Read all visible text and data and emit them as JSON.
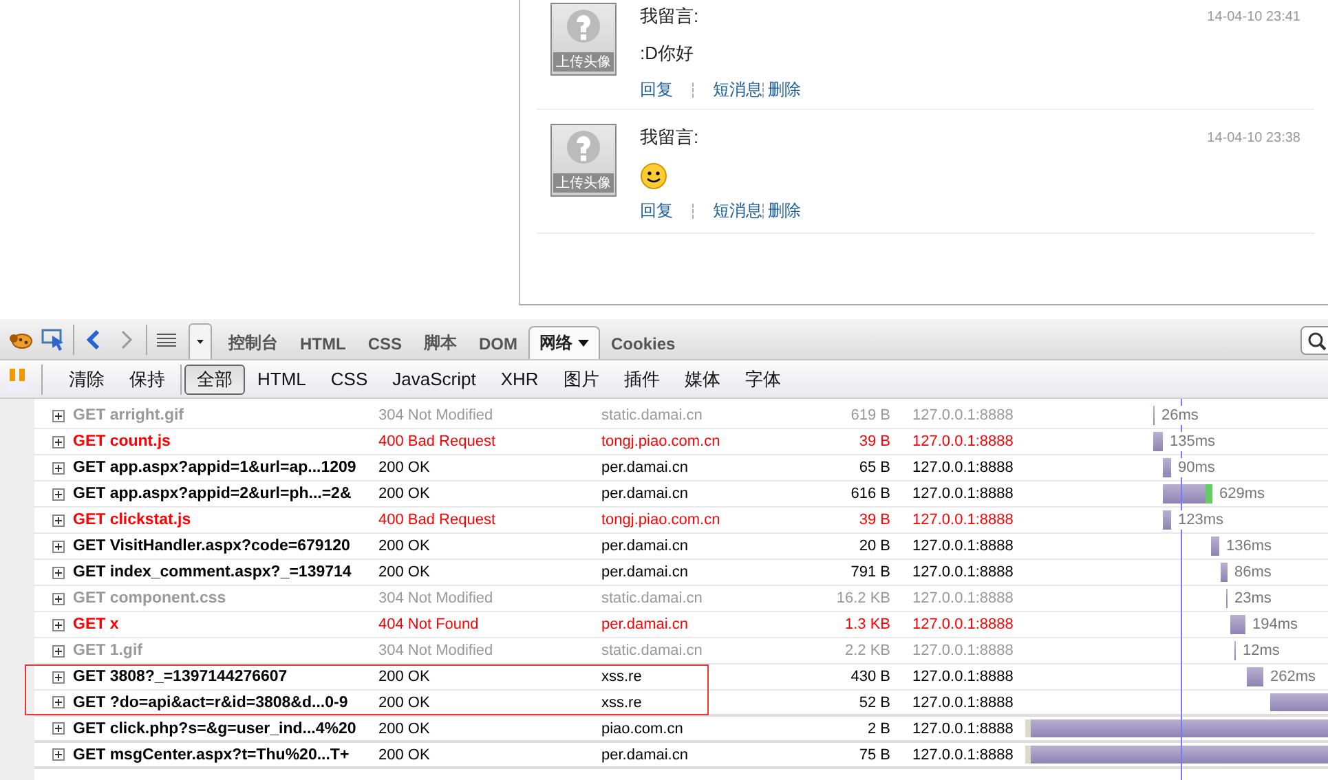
{
  "comments": [
    {
      "author": "我留言:",
      "time": "14-04-10 23:41",
      "kind": "text",
      "content": ":D你好",
      "avatar_caption": "上传头像",
      "actions": [
        "回复",
        "短消息",
        "删除"
      ]
    },
    {
      "author": "我留言:",
      "time": "14-04-10 23:38",
      "kind": "smiley",
      "avatar_caption": "上传头像",
      "actions": [
        "回复",
        "短消息",
        "删除"
      ]
    }
  ],
  "toolbar": {
    "tabs": [
      {
        "label": "控制台",
        "selected": false
      },
      {
        "label": "HTML",
        "selected": false
      },
      {
        "label": "CSS",
        "selected": false
      },
      {
        "label": "脚本",
        "selected": false
      },
      {
        "label": "DOM",
        "selected": false
      },
      {
        "label": "网络",
        "selected": true,
        "dropdown": true
      },
      {
        "label": "Cookies",
        "selected": false
      }
    ]
  },
  "filter_bar": {
    "actions": [
      "清除",
      "保持"
    ],
    "filters": [
      {
        "label": "全部",
        "selected": true
      },
      {
        "label": "HTML",
        "selected": false
      },
      {
        "label": "CSS",
        "selected": false
      },
      {
        "label": "JavaScript",
        "selected": false
      },
      {
        "label": "XHR",
        "selected": false
      },
      {
        "label": "图片",
        "selected": false
      },
      {
        "label": "插件",
        "selected": false
      },
      {
        "label": "媒体",
        "selected": false
      },
      {
        "label": "字体",
        "selected": false
      }
    ]
  },
  "requests": [
    {
      "kind": "cached",
      "url": "GET arright.gif",
      "status": "304 Not Modified",
      "domain": "static.damai.cn",
      "size": "619 B",
      "remote": "127.0.0.1:8888",
      "highlighted": false,
      "timing": "26ms"
    },
    {
      "kind": "error",
      "url": "GET count.js",
      "status": "400 Bad Request",
      "domain": "tongj.piao.com.cn",
      "size": "39 B",
      "remote": "127.0.0.1:8888",
      "highlighted": false,
      "timing": "135ms"
    },
    {
      "kind": "ok",
      "url": "GET app.aspx?appid=1&url=ap...1209",
      "status": "200 OK",
      "domain": "per.damai.cn",
      "size": "65 B",
      "remote": "127.0.0.1:8888",
      "highlighted": false,
      "timing": "90ms"
    },
    {
      "kind": "ok",
      "url": "GET app.aspx?appid=2&url=ph...=2&",
      "status": "200 OK",
      "domain": "per.damai.cn",
      "size": "616 B",
      "remote": "127.0.0.1:8888",
      "highlighted": false,
      "timing": "629ms"
    },
    {
      "kind": "error",
      "url": "GET clickstat.js",
      "status": "400 Bad Request",
      "domain": "tongj.piao.com.cn",
      "size": "39 B",
      "remote": "127.0.0.1:8888",
      "highlighted": false,
      "timing": "123ms"
    },
    {
      "kind": "ok",
      "url": "GET VisitHandler.aspx?code=679120",
      "status": "200 OK",
      "domain": "per.damai.cn",
      "size": "20 B",
      "remote": "127.0.0.1:8888",
      "highlighted": false,
      "timing": "136ms"
    },
    {
      "kind": "ok",
      "url": "GET index_comment.aspx?_=139714",
      "status": "200 OK",
      "domain": "per.damai.cn",
      "size": "791 B",
      "remote": "127.0.0.1:8888",
      "highlighted": false,
      "timing": "86ms"
    },
    {
      "kind": "cached",
      "url": "GET component.css",
      "status": "304 Not Modified",
      "domain": "static.damai.cn",
      "size": "16.2 KB",
      "remote": "127.0.0.1:8888",
      "highlighted": false,
      "timing": "23ms"
    },
    {
      "kind": "error",
      "url": "GET x",
      "status": "404 Not Found",
      "domain": "per.damai.cn",
      "size": "1.3 KB",
      "remote": "127.0.0.1:8888",
      "highlighted": false,
      "timing": "194ms"
    },
    {
      "kind": "cached",
      "url": "GET 1.gif",
      "status": "304 Not Modified",
      "domain": "static.damai.cn",
      "size": "2.2 KB",
      "remote": "127.0.0.1:8888",
      "highlighted": false,
      "timing": "12ms"
    },
    {
      "kind": "ok",
      "url": "GET 3808?_=1397144276607",
      "status": "200 OK",
      "domain": "xss.re",
      "size": "430 B",
      "remote": "127.0.0.1:8888",
      "highlighted": true,
      "timing": "262ms"
    },
    {
      "kind": "ok",
      "url": "GET ?do=api&act=r&id=3808&d...0-9",
      "status": "200 OK",
      "domain": "xss.re",
      "size": "52 B",
      "remote": "127.0.0.1:8888",
      "highlighted": true
    },
    {
      "kind": "ok",
      "url": "GET click.php?s=&g=user_ind...4%20",
      "status": "200 OK",
      "domain": "piao.com.cn",
      "size": "2 B",
      "remote": "127.0.0.1:8888",
      "highlighted": false
    },
    {
      "kind": "ok",
      "url": "GET msgCenter.aspx?t=Thu%20...T+",
      "status": "200 OK",
      "domain": "per.damai.cn",
      "size": "75 B",
      "remote": "127.0.0.1:8888",
      "highlighted": false
    }
  ]
}
